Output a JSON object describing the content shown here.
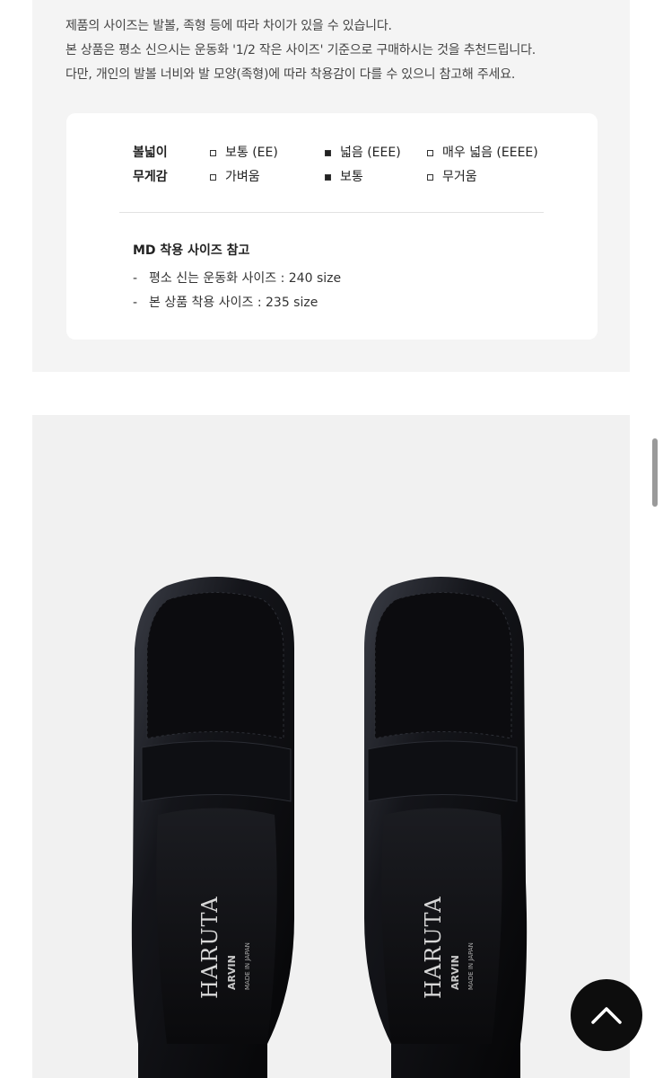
{
  "notice": {
    "line1": "제품의 사이즈는 발볼, 족형 등에 따라 차이가 있을 수 있습니다.",
    "line2": "본 상품은 평소 신으시는 운동화 '1/2 작은 사이즈' 기준으로 구매하시는 것을 추천드립니다.",
    "line3": "다만, 개인의 발볼 너비와 발 모양(족형)에 따라 착용감이 다를 수 있으니 참고해 주세요."
  },
  "spec": {
    "width": {
      "label": "볼넓이",
      "options": [
        {
          "text": "보통 (EE)",
          "checked": false
        },
        {
          "text": "넓음 (EEE)",
          "checked": true
        },
        {
          "text": "매우 넓음 (EEEE)",
          "checked": false
        }
      ]
    },
    "weight": {
      "label": "무게감",
      "options": [
        {
          "text": "가벼움",
          "checked": false
        },
        {
          "text": "보통",
          "checked": true
        },
        {
          "text": "무거움",
          "checked": false
        }
      ]
    }
  },
  "md": {
    "title": "MD 착용 사이즈 참고",
    "items": [
      {
        "dash": "-",
        "text": "평소 신는 운동화 사이즈 : 240 size"
      },
      {
        "dash": "-",
        "text": "본 상품 착용 사이즈 : 235 size"
      }
    ]
  },
  "product_image": {
    "brand": "HARUTA",
    "sub_brand": "ARVIN",
    "made_in": "MADE IN JAPAN"
  },
  "colors": {
    "panel_bg": "#f4f4f4",
    "card_bg": "#ffffff",
    "shoe": "#0f0f12",
    "top_button": "#0d0d0d"
  },
  "icons": {
    "scroll_top": "chevron-up-icon"
  }
}
